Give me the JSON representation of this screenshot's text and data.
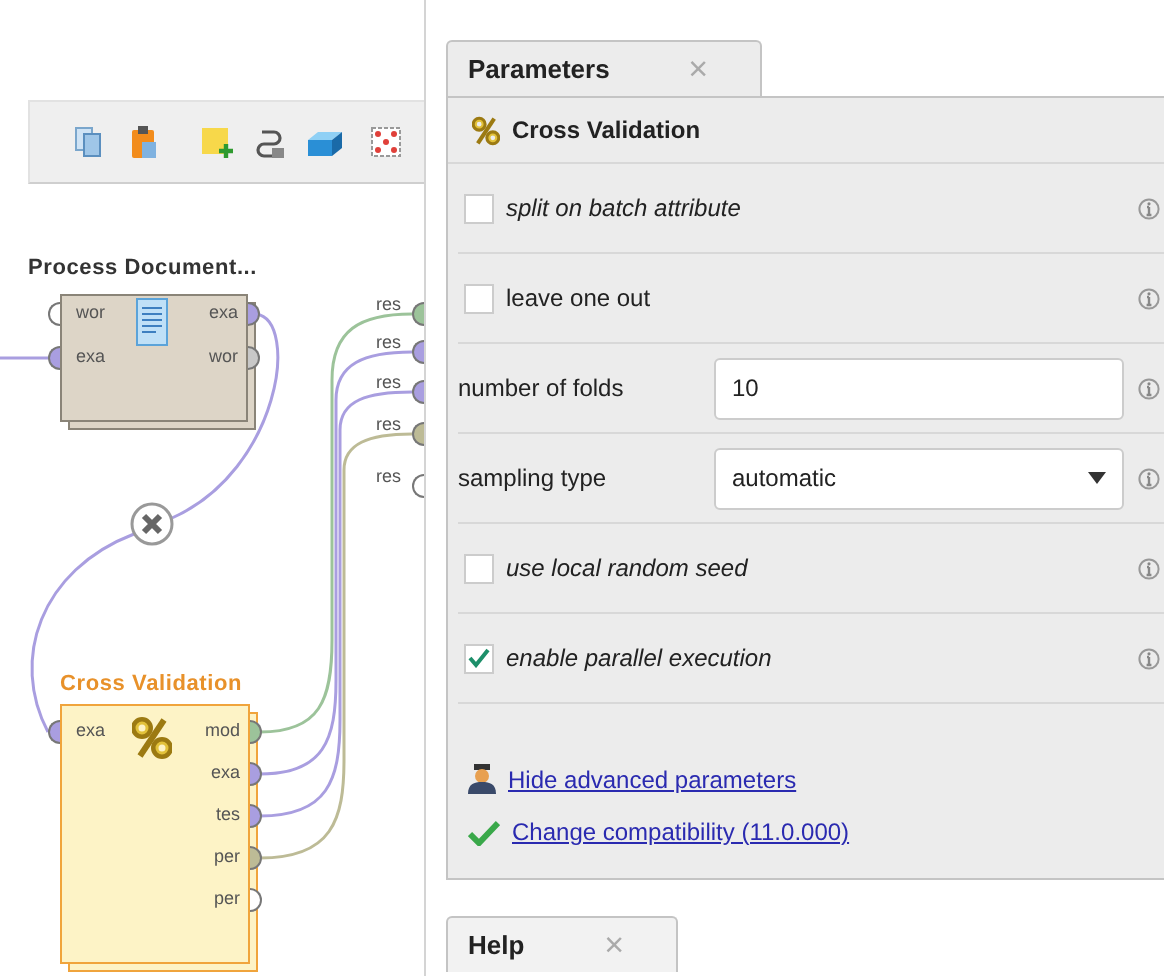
{
  "process_canvas": {
    "operators": [
      {
        "name": "Process Document...",
        "kind": "document",
        "selected": false,
        "inputs": [
          {
            "label": "wor",
            "color": "#ffffff"
          },
          {
            "label": "exa",
            "color": "#a99ee0"
          }
        ],
        "outputs": [
          {
            "label": "exa",
            "color": "#a99ee0"
          },
          {
            "label": "wor",
            "color": "#c8c8c8"
          }
        ]
      },
      {
        "name": "Cross Validation",
        "kind": "validation",
        "selected": true,
        "inputs": [
          {
            "label": "exa",
            "color": "#a99ee0"
          }
        ],
        "outputs": [
          {
            "label": "mod",
            "color": "#9cc39a"
          },
          {
            "label": "exa",
            "color": "#a99ee0"
          },
          {
            "label": "tes",
            "color": "#a99ee0"
          },
          {
            "label": "per",
            "color": "#bdbb96"
          },
          {
            "label": "per",
            "color": "#ffffff"
          }
        ]
      }
    ],
    "result_ports": [
      {
        "label": "res",
        "color": "#9cc39a"
      },
      {
        "label": "res",
        "color": "#a99ee0"
      },
      {
        "label": "res",
        "color": "#a99ee0"
      },
      {
        "label": "res",
        "color": "#bdbb96"
      },
      {
        "label": "res",
        "color": "#ffffff"
      }
    ]
  },
  "parameters": {
    "tab": {
      "label": "Parameters",
      "selected": true,
      "close": "×"
    },
    "operator": "Cross Validation",
    "rows": [
      {
        "kind": "checkbox",
        "label": "split on batch attribute",
        "advanced": true,
        "checked": false
      },
      {
        "kind": "checkbox",
        "label": "leave one out",
        "advanced": false,
        "checked": false
      },
      {
        "kind": "number",
        "label": "number of folds",
        "value": "10"
      },
      {
        "kind": "select",
        "label": "sampling type",
        "value": "automatic"
      },
      {
        "kind": "checkbox",
        "label": "use local random seed",
        "advanced": true,
        "checked": false
      },
      {
        "kind": "checkbox",
        "label": "enable parallel execution",
        "advanced": true,
        "checked": true
      }
    ],
    "links": [
      {
        "kind": "advanced",
        "label": "Hide advanced parameters"
      },
      {
        "kind": "compatibility",
        "label": "Change compatibility (11.0.000)"
      }
    ]
  },
  "help": {
    "tab": {
      "label": "Help",
      "selected": false,
      "close": "×"
    }
  }
}
